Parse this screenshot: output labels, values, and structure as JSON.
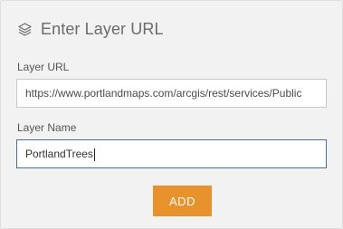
{
  "dialog": {
    "title": "Enter Layer URL",
    "icon": "layers-icon"
  },
  "form": {
    "url_label": "Layer URL",
    "url_value": "https://www.portlandmaps.com/arcgis/rest/services/Publi​c",
    "name_label": "Layer Name",
    "name_value": "PortlandTrees"
  },
  "actions": {
    "add_label": "ADD"
  },
  "colors": {
    "accent": "#e8922d",
    "focus_border": "#4a6f96",
    "panel_bg": "#f2f2f2"
  }
}
